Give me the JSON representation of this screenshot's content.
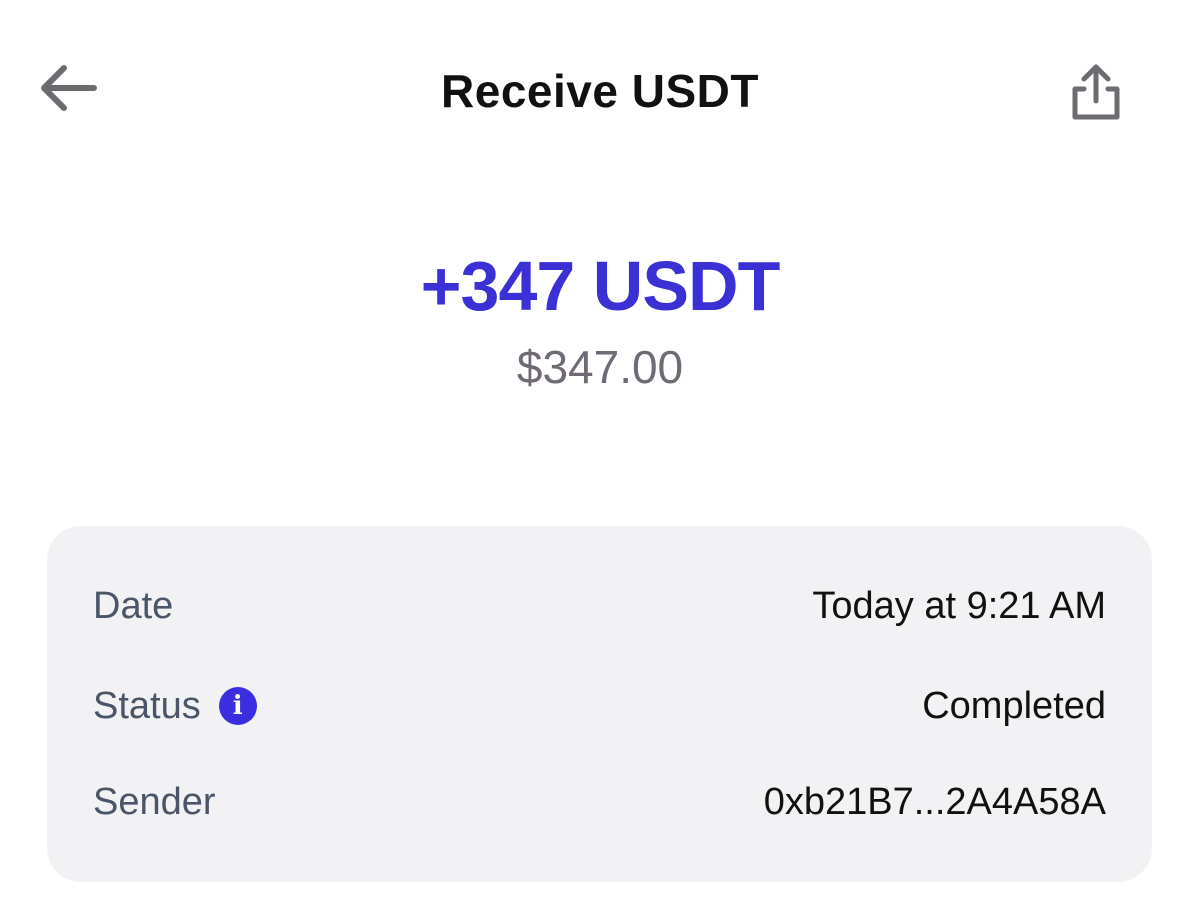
{
  "header": {
    "title": "Receive USDT",
    "back_icon": "arrow-left-icon",
    "share_icon": "share-icon"
  },
  "transaction": {
    "amount": "+347 USDT",
    "fiat_value": "$347.00",
    "accent_color": "#3b2fd6"
  },
  "details": {
    "date_label": "Date",
    "date_value": "Today at 9:21 AM",
    "status_label": "Status",
    "status_info_icon": "info-icon",
    "status_value": "Completed",
    "sender_label": "Sender",
    "sender_value": "0xb21B7...2A4A58A"
  }
}
